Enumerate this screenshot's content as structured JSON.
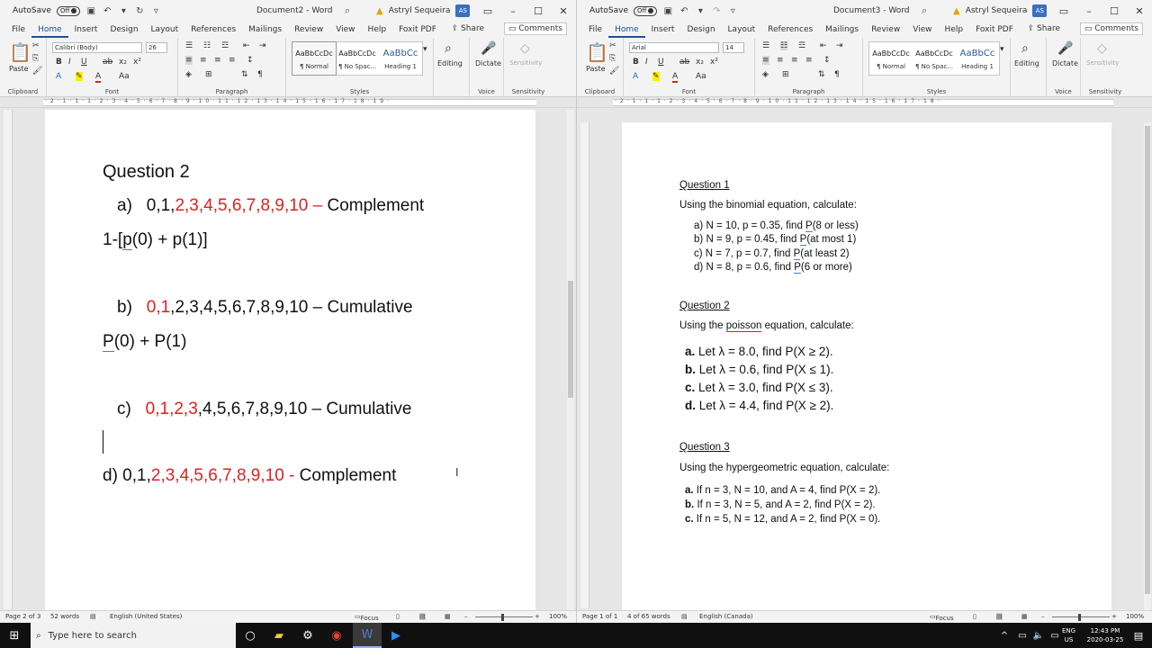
{
  "left": {
    "autosave_label": "AutoSave",
    "autosave_state": "Off",
    "doc_title": "Document2 - Word",
    "user_name": "Astryl Sequeira",
    "user_initials": "AS",
    "tabs": [
      "File",
      "Home",
      "Insert",
      "Design",
      "Layout",
      "References",
      "Mailings",
      "Review",
      "View",
      "Help",
      "Foxit PDF"
    ],
    "share_label": "Share",
    "comments_label": "Comments",
    "font_name": "Calibri (Body)",
    "font_size": "26",
    "styles": [
      {
        "preview": "AaBbCcDc",
        "name": "¶ Normal"
      },
      {
        "preview": "AaBbCcDc",
        "name": "¶ No Spac..."
      },
      {
        "preview": "AaBbCc",
        "name": "Heading 1"
      }
    ],
    "groups": {
      "clipboard": "Clipboard",
      "font": "Font",
      "paragraph": "Paragraph",
      "styles": "Styles",
      "voice": "Voice",
      "sensitivity": "Sensitivity"
    },
    "paste_label": "Paste",
    "editing_label": "Editing",
    "dictate_label": "Dictate",
    "sensitivity_label": "Sensitivity",
    "ruler_nums": "·2·1·1·1·2·3·4·5·6·7·8·9·10·11·12·13·14·15·16·17·18·19·",
    "content": {
      "heading": "Question 2",
      "a_label": "a)",
      "a_black": "0,1,",
      "a_red": "2,3,4,5,6,7,8,9,10 –",
      "a_tail": " Complement",
      "a_formula_pre": "1-[",
      "a_formula_p": "p",
      "a_formula_rest": "(0) + p(1)]",
      "b_label": "b)",
      "b_red": "0,1",
      "b_tail": ",2,3,4,5,6,7,8,9,10 – Cumulative",
      "b_formula_p": "P",
      "b_formula_rest": "(0) + P(1)",
      "c_label": "c)",
      "c_red": "0,1,2,3",
      "c_tail": ",4,5,6,7,8,9,10 – Cumulative",
      "d_black": "d) 0,1,",
      "d_red": "2,3,4,5,6,7,8,9,10 -",
      "d_tail": " Complement"
    },
    "status": {
      "page": "Page 2 of 3",
      "words": "52 words",
      "lang": "English (United States)",
      "focus": "Focus",
      "zoom": "100%"
    }
  },
  "right": {
    "autosave_label": "AutoSave",
    "autosave_state": "Off",
    "doc_title": "Document3 - Word",
    "user_name": "Astryl Sequeira",
    "user_initials": "AS",
    "tabs": [
      "File",
      "Home",
      "Insert",
      "Design",
      "Layout",
      "References",
      "Mailings",
      "Review",
      "View",
      "Help",
      "Foxit PDF"
    ],
    "share_label": "Share",
    "comments_label": "Comments",
    "font_name": "Arial",
    "font_size": "14",
    "styles": [
      {
        "preview": "AaBbCcDc",
        "name": "¶ Normal"
      },
      {
        "preview": "AaBbCcDc",
        "name": "¶ No Spac..."
      },
      {
        "preview": "AaBbCc",
        "name": "Heading 1"
      }
    ],
    "groups": {
      "clipboard": "Clipboard",
      "font": "Font",
      "paragraph": "Paragraph",
      "styles": "Styles",
      "voice": "Voice",
      "sensitivity": "Sensitivity"
    },
    "paste_label": "Paste",
    "editing_label": "Editing",
    "dictate_label": "Dictate",
    "sensitivity_label": "Sensitivity",
    "ruler_nums": "·2·1·1·1·2·3·4·5·6·7·8·9·10·11·12·13·14·15·16·17·18·",
    "content": {
      "q1_title": "Question 1",
      "q1_intro": "Using the binomial equation, calculate:",
      "q1_items": [
        {
          "label": "a)",
          "pre": "N = 10, p = 0.35, find ",
          "p": "P",
          "post": "(8 or less)"
        },
        {
          "label": "b)",
          "pre": "N = 9, p = 0.45, find ",
          "p": "P",
          "post": "(at most 1)"
        },
        {
          "label": "c)",
          "pre": "N = 7, p = 0.7, find ",
          "p": "P",
          "post": "(at least 2)"
        },
        {
          "label": "d)",
          "pre": "N = 8, p = 0.6, find ",
          "p": "P",
          "post": "(6 or more)"
        }
      ],
      "q2_title": "Question 2",
      "q2_intro_pre": "Using the ",
      "q2_intro_word": "poisson",
      "q2_intro_post": " equation, calculate:",
      "q2_items": [
        {
          "label": "a.",
          "text": "Let λ = 8.0, find P(X ≥ 2)."
        },
        {
          "label": "b.",
          "text": "Let λ = 0.6, find P(X ≤ 1)."
        },
        {
          "label": "c.",
          "text": "Let λ = 3.0, find P(X ≤ 3)."
        },
        {
          "label": "d.",
          "text": "Let λ = 4.4, find P(X ≥ 2)."
        }
      ],
      "q3_title": "Question 3",
      "q3_intro": "Using the hypergeometric equation, calculate:",
      "q3_items": [
        {
          "label": "a.",
          "text": "If n = 3, N = 10, and A = 4, find P(X = 2)."
        },
        {
          "label": "b.",
          "text": "If n = 3, N = 5, and A = 2, find P(X = 2)."
        },
        {
          "label": "c.",
          "text": "If n = 5, N = 12, and A = 2, find P(X = 0)."
        }
      ]
    },
    "status": {
      "page": "Page 1 of 1",
      "words": "4 of 65 words",
      "lang": "English (Canada)",
      "focus": "Focus",
      "zoom": "100%"
    }
  },
  "taskbar": {
    "search_placeholder": "Type here to search",
    "lang_top": "ENG",
    "lang_bottom": "US",
    "time": "12:43 PM",
    "date": "2020-03-25"
  }
}
